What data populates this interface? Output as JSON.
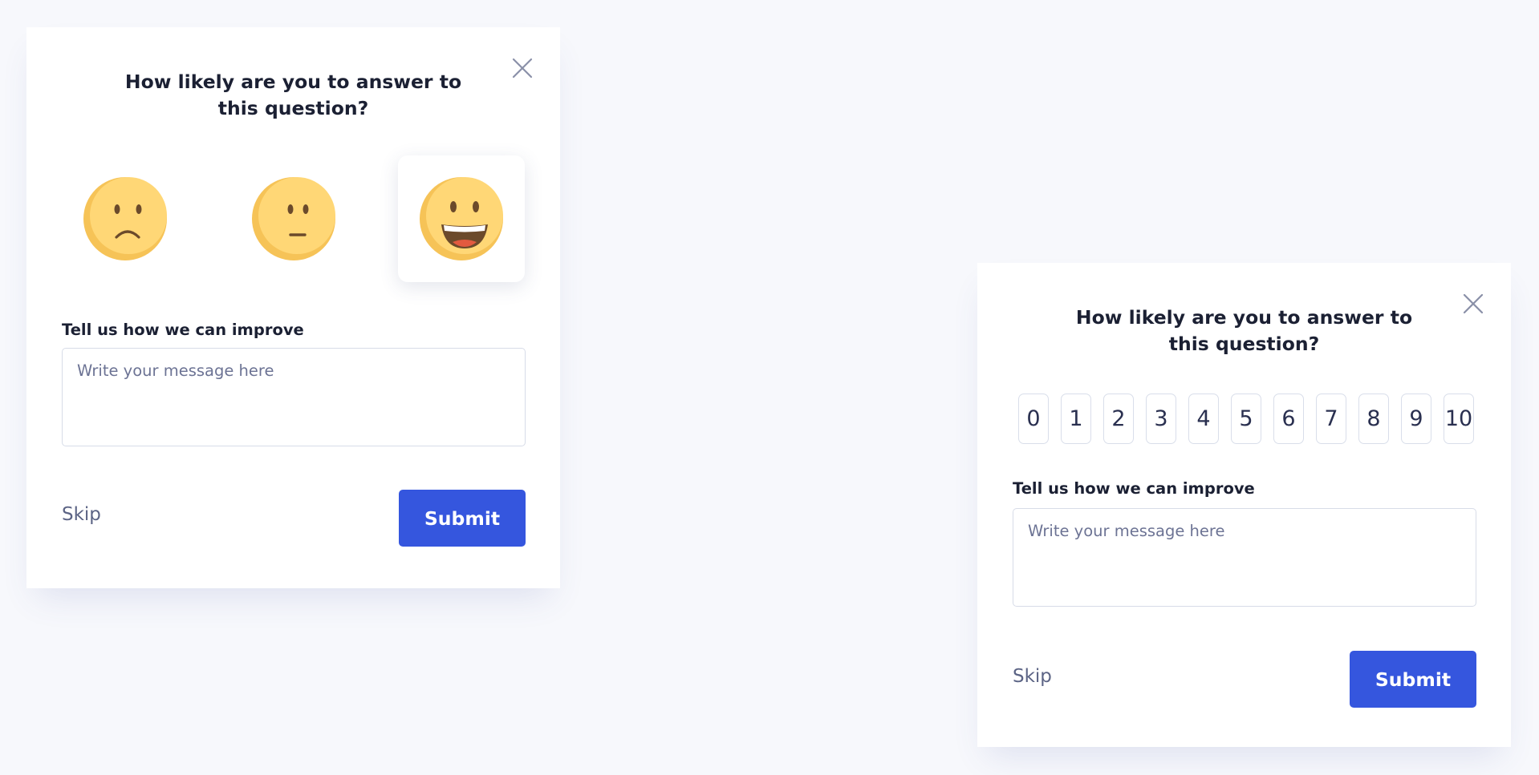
{
  "survey_emoji": {
    "title": "How likely are you to answer to this question?",
    "options": [
      {
        "icon": "sad-face-icon"
      },
      {
        "icon": "neutral-face-icon"
      },
      {
        "icon": "happy-face-icon",
        "selected": true
      }
    ],
    "feedback_label": "Tell us how we can improve",
    "message_placeholder": "Write your message here",
    "skip_label": "Skip",
    "submit_label": "Submit"
  },
  "survey_nps": {
    "title": "How likely are you to answer to this question?",
    "scores": [
      "0",
      "1",
      "2",
      "3",
      "4",
      "5",
      "6",
      "7",
      "8",
      "9",
      "10"
    ],
    "feedback_label": "Tell us how we can improve",
    "message_placeholder": "Write your message here",
    "skip_label": "Skip",
    "submit_label": "Submit"
  },
  "colors": {
    "accent": "#3556de",
    "background": "#f7f8fc",
    "emoji_face": "#ffd36e"
  },
  "icons": {
    "close": "close-icon"
  }
}
